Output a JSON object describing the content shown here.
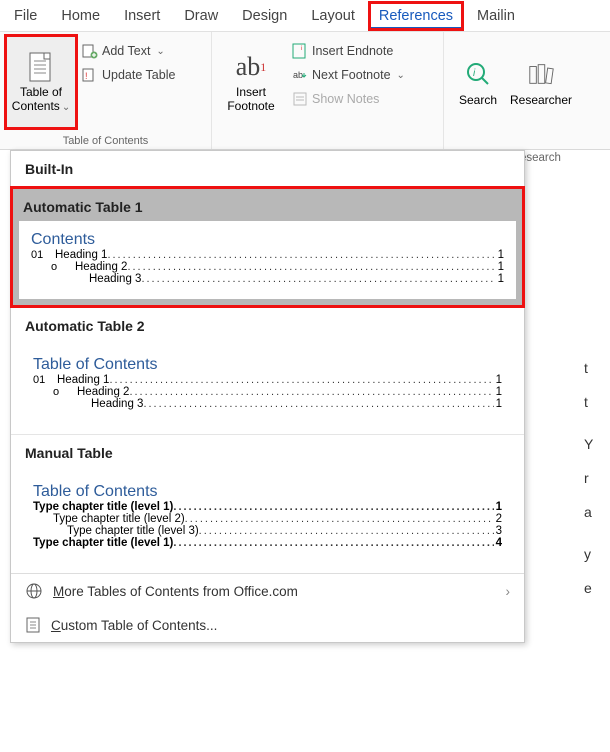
{
  "tabs": {
    "file": "File",
    "home": "Home",
    "insert": "Insert",
    "draw": "Draw",
    "design": "Design",
    "layout": "Layout",
    "references": "References",
    "mailings": "Mailin"
  },
  "ribbon": {
    "toc": {
      "line1": "Table of",
      "line2": "Contents"
    },
    "toc_group_label": "Table of Contents",
    "add_text": "Add Text",
    "update_table": "Update Table",
    "insert_footnote": {
      "line1": "Insert",
      "line2": "Footnote",
      "ab": "ab",
      "sup": "1"
    },
    "insert_endnote": "Insert Endnote",
    "next_footnote": "Next Footnote",
    "show_notes": "Show Notes",
    "search": "Search",
    "researcher": "Researcher",
    "research_group_label": "esearch"
  },
  "menu": {
    "builtin_header": "Built-In",
    "auto1": {
      "title": "Automatic Table 1",
      "toc_title": "Contents",
      "rows": [
        {
          "bullet": "01",
          "text": "Heading 1",
          "page": "1"
        },
        {
          "bullet": "o",
          "text": "Heading 2",
          "page": "1"
        },
        {
          "bullet": "",
          "text": "Heading 3",
          "page": "1"
        }
      ]
    },
    "auto2": {
      "title": "Automatic Table 2",
      "toc_title": "Table of Contents",
      "rows": [
        {
          "bullet": "01",
          "text": "Heading 1",
          "page": "1"
        },
        {
          "bullet": "o",
          "text": "Heading 2",
          "page": "1"
        },
        {
          "bullet": "",
          "text": "Heading 3",
          "page": "1"
        }
      ]
    },
    "manual": {
      "title": "Manual Table",
      "toc_title": "Table of Contents",
      "rows": [
        {
          "text": "Type chapter title (level 1)",
          "page": "1"
        },
        {
          "text": "Type chapter title (level 2)",
          "page": "2"
        },
        {
          "text": "Type chapter title (level 3)",
          "page": "3"
        },
        {
          "text": "Type chapter title (level 1)",
          "page": "4"
        }
      ]
    },
    "more_office": {
      "pre": "M",
      "rest": "ore Tables of Contents from Office.com"
    },
    "custom": {
      "pre": "C",
      "rest": "ustom Table of Contents..."
    }
  }
}
